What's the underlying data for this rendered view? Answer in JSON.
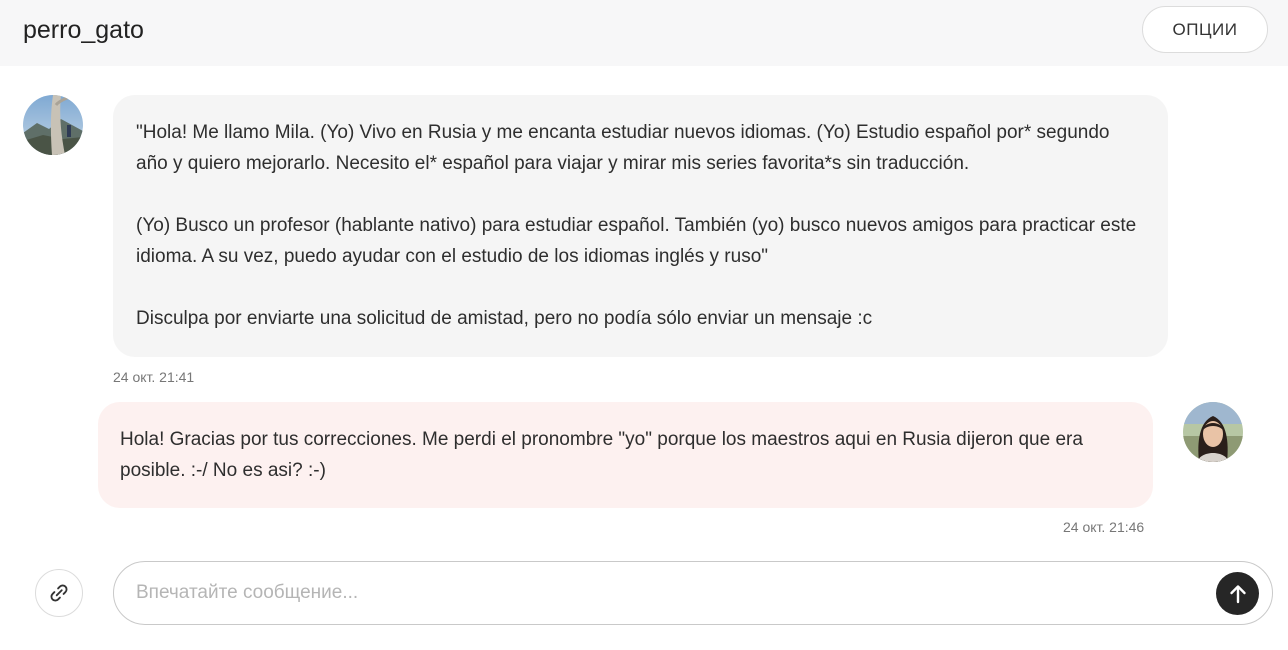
{
  "header": {
    "title": "perro_gato",
    "options_label": "ОПЦИИ"
  },
  "messages": [
    {
      "direction": "incoming",
      "avatar": "landscape-photo-avatar",
      "paragraphs": [
        "\"Hola! Me llamo Mila. (Yo) Vivo en Rusia y me encanta estudiar nuevos idiomas. (Yo) Estudio español por* segundo año y quiero mejorarlo. Necesito el* español para viajar y mirar mis series favorita*s sin traducción.",
        "(Yo) Busco un profesor (hablante nativo) para estudiar español. También (yo) busco nuevos amigos para practicar este idioma. A su vez, puedo ayudar con el estudio de los idiomas inglés y ruso\"",
        "Disculpa por enviarte una solicitud de amistad, pero no podía sólo enviar un mensaje :c"
      ],
      "time": "24 окт. 21:41",
      "bubble_color": "#f5f5f5"
    },
    {
      "direction": "outgoing",
      "avatar": "woman-portrait-avatar",
      "paragraphs": [
        "Hola! Gracias por tus correcciones. Me perdi el pronombre \"yo\" porque los maestros aqui en Rusia dijeron que era posible. :-/ No es asi? :-)"
      ],
      "time": "24 окт. 21:46",
      "bubble_color": "#fdf1f0"
    }
  ],
  "composer": {
    "placeholder": "Впечатайте сообщение...",
    "value": "",
    "attach_icon": "paperclip-icon",
    "send_icon": "arrow-up-icon"
  }
}
